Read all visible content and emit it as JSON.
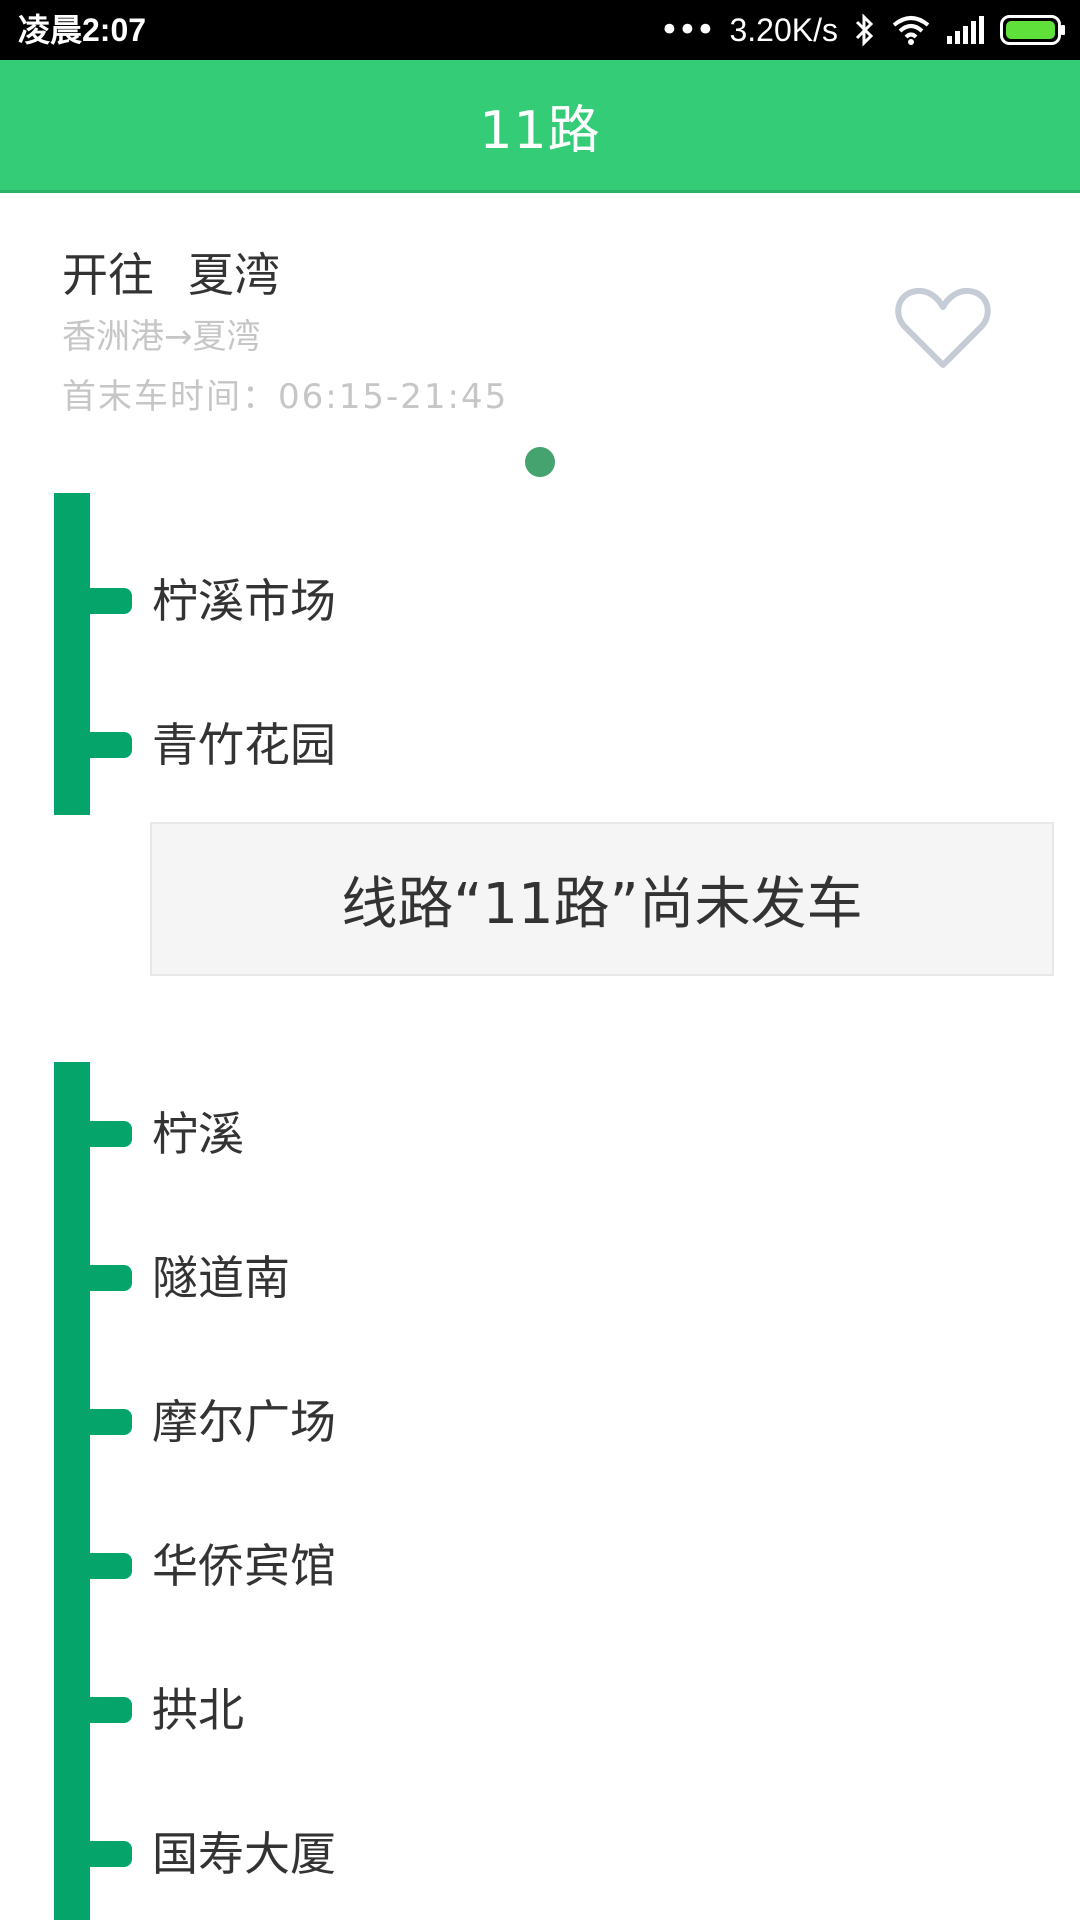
{
  "status_bar": {
    "time": "凌晨2:07",
    "dots": "•••",
    "net_speed": "3.20K/s",
    "icons": [
      "bluetooth-icon",
      "wifi-icon",
      "signal-icon",
      "battery-icon"
    ],
    "battery_color": "#5fe03a"
  },
  "app_bar": {
    "title": "11路",
    "color": "#35cc77"
  },
  "route": {
    "direction_label": "开往",
    "direction_dest": "夏湾",
    "ends": "香洲港→夏湾",
    "service_hours": "首末车时间：06:15-21:45",
    "favorite_icon": "heart-outline-icon"
  },
  "stops_before": [
    {
      "name": "柠溪市场"
    },
    {
      "name": "青竹花园"
    }
  ],
  "notice": "线路“11路”尚未发车",
  "stops_after": [
    {
      "name": "柠溪"
    },
    {
      "name": "隧道南"
    },
    {
      "name": "摩尔广场"
    },
    {
      "name": "华侨宾馆"
    },
    {
      "name": "拱北"
    },
    {
      "name": "国寿大厦"
    }
  ],
  "line_color": "#04a46b"
}
